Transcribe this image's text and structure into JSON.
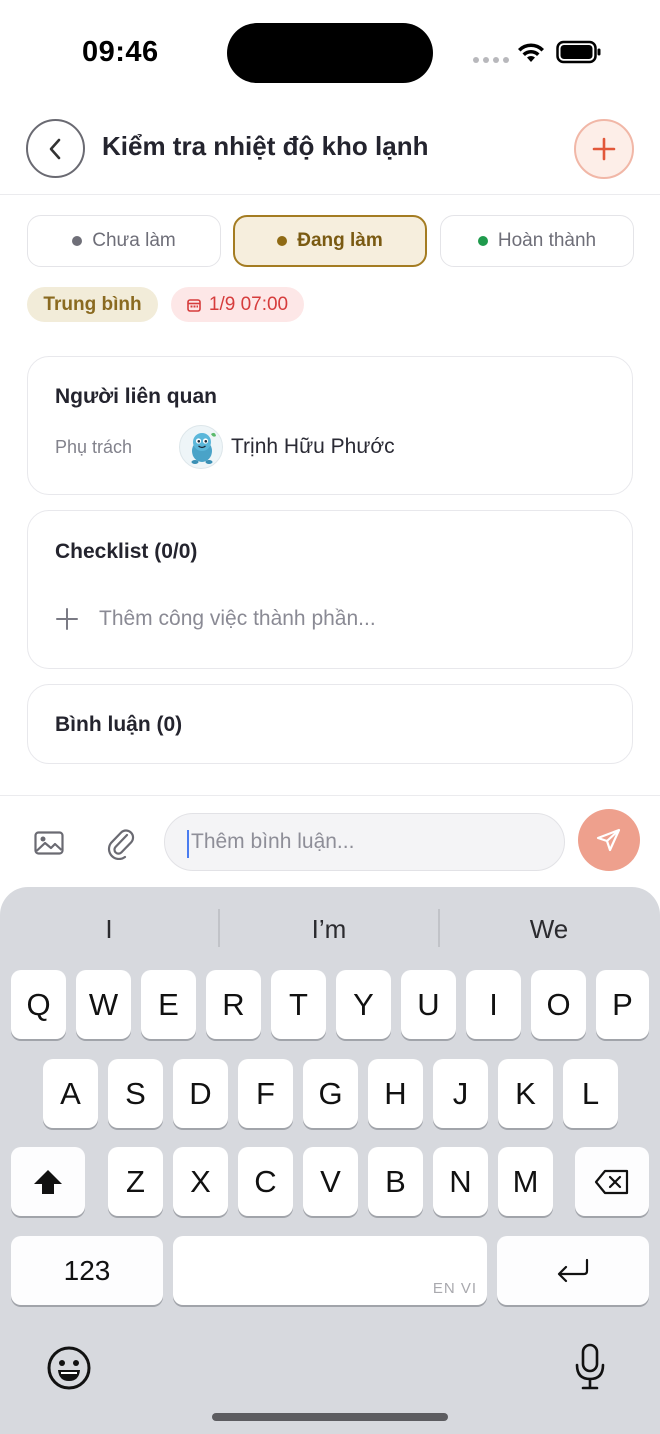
{
  "status_bar": {
    "time": "09:46"
  },
  "header": {
    "title": "Kiểm tra nhiệt độ kho lạnh"
  },
  "status_tabs": [
    {
      "label": "Chưa làm",
      "dot_color": "#6f6f78",
      "active": false
    },
    {
      "label": "Đang làm",
      "dot_color": "#8f6a14",
      "active": true
    },
    {
      "label": "Hoàn thành",
      "dot_color": "#1f9a4c",
      "active": false
    }
  ],
  "chips": {
    "priority": "Trung bình",
    "due": "1/9 07:00"
  },
  "people": {
    "title": "Người liên quan",
    "role": "Phụ trách",
    "assignee": "Trịnh Hữu Phước"
  },
  "checklist": {
    "title": "Checklist (0/0)",
    "add_placeholder": "Thêm công việc thành phần..."
  },
  "comments": {
    "title": "Bình luận (0)"
  },
  "comment_bar": {
    "placeholder": "Thêm bình luận..."
  },
  "keyboard": {
    "suggestions": [
      "I",
      "I’m",
      "We"
    ],
    "row1": [
      "Q",
      "W",
      "E",
      "R",
      "T",
      "Y",
      "U",
      "I",
      "O",
      "P"
    ],
    "row2": [
      "A",
      "S",
      "D",
      "F",
      "G",
      "H",
      "J",
      "K",
      "L"
    ],
    "row3": [
      "Z",
      "X",
      "C",
      "V",
      "B",
      "N",
      "M"
    ],
    "numbers_key": "123",
    "lang_hint": "EN VI"
  },
  "colors": {
    "accent": "#e8573a",
    "send": "#eea08d",
    "active_tab": "#a47c22",
    "due_text": "#d63c3c"
  }
}
